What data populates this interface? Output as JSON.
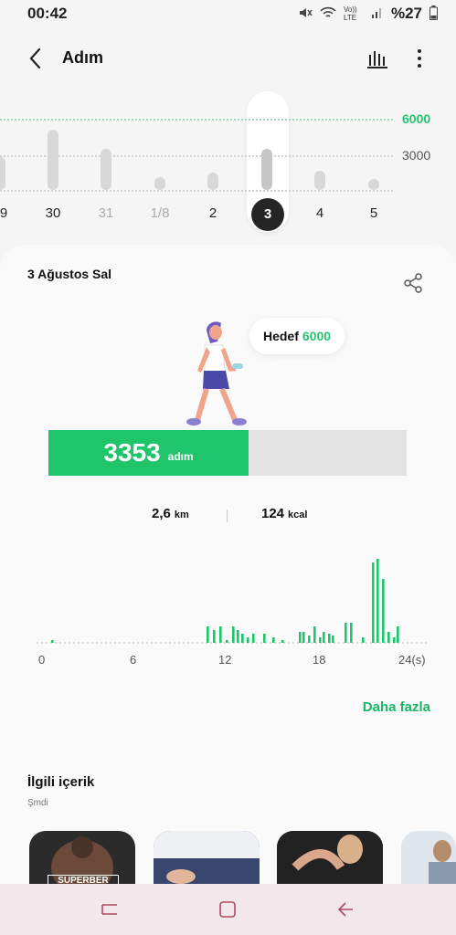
{
  "status": {
    "time": "00:42",
    "network": "Vo)) LTE",
    "battery": "%27"
  },
  "header": {
    "title": "Adım"
  },
  "week_chart": {
    "goal_label": "6000",
    "mid_label": "3000",
    "accent": "#27c471",
    "days": [
      "9",
      "30",
      "31",
      "1/8",
      "2",
      "3",
      "4",
      "5"
    ],
    "selected": "3"
  },
  "summary": {
    "date": "3 Ağustos Sal",
    "goal_label": "Hedef",
    "goal_value": "6000",
    "steps": "3353",
    "steps_unit": "adım",
    "steps_value": 3353,
    "goal_number": 6000,
    "distance": "2,6",
    "distance_unit": "km",
    "calories": "124",
    "calories_unit": "kcal"
  },
  "day_chart": {
    "x_ticks": [
      "0",
      "6",
      "12",
      "18",
      "24(s)"
    ],
    "color": "#1ec56b"
  },
  "more_label": "Daha fazla",
  "related": {
    "title": "İlgili içerik",
    "subtitle": "Şmdi",
    "thumb1_text": "SUPERBER"
  },
  "nav": {
    "recent": "recent-apps-icon",
    "home": "home-icon",
    "back": "back-icon"
  }
}
